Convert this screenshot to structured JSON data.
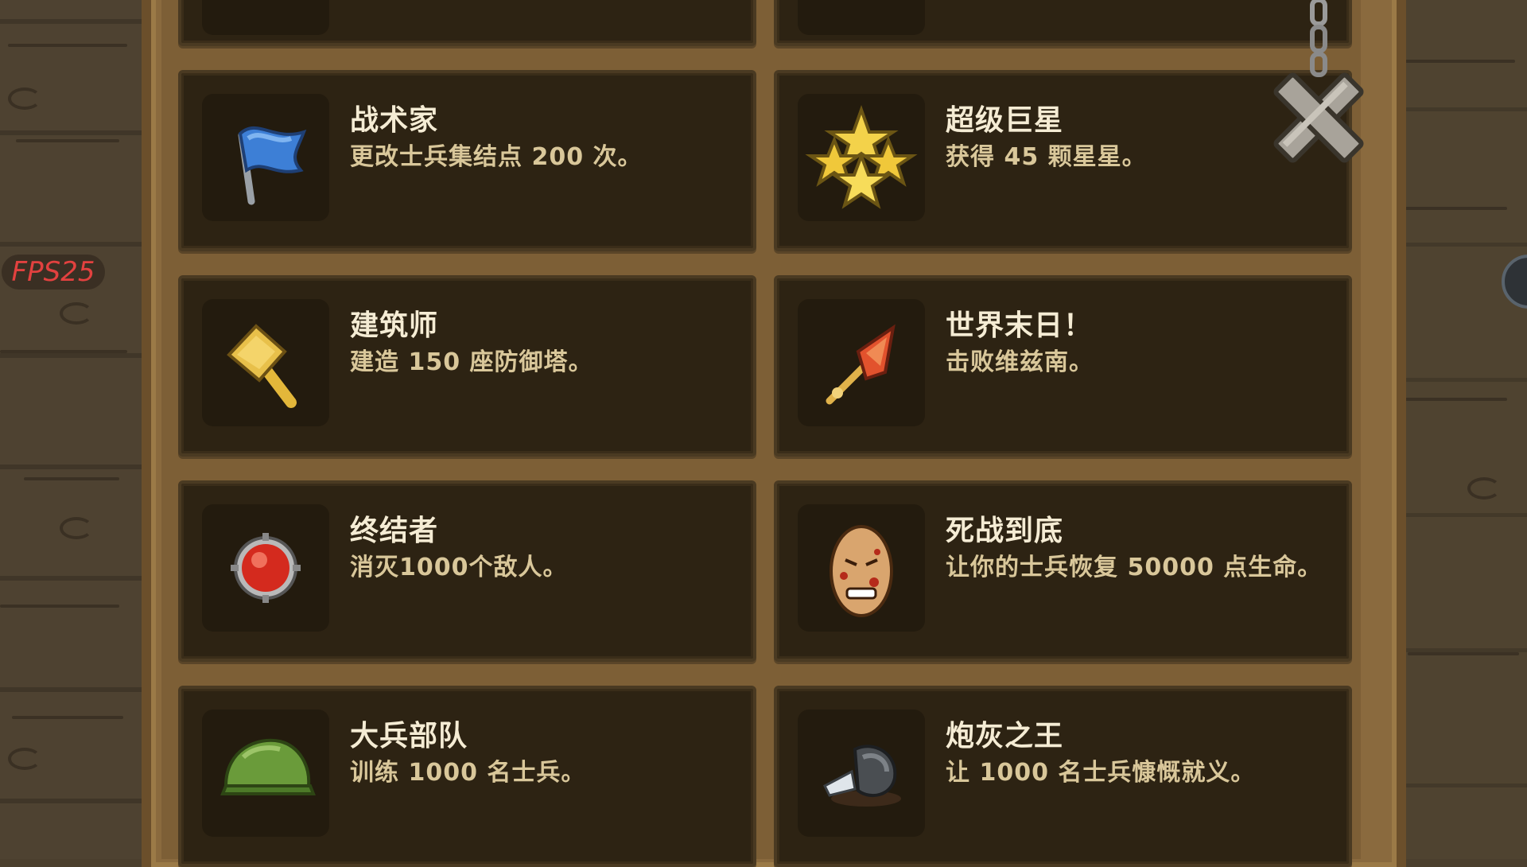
{
  "hud": {
    "fps_label": "FPS25"
  },
  "close_button": {
    "icon": "close-x-icon"
  },
  "achievements": [
    {
      "title": "战术家",
      "description": "更改士兵集结点 200 次。",
      "icon": "blue-flag-icon"
    },
    {
      "title": "超级巨星",
      "description": "获得 45 颗星星。",
      "icon": "stars-icon"
    },
    {
      "title": "建筑师",
      "description": "建造 150 座防御塔。",
      "icon": "hammer-icon"
    },
    {
      "title": "世界末日！",
      "description": "击败维兹南。",
      "icon": "fire-staff-icon"
    },
    {
      "title": "终结者",
      "description": "消灭1000个敌人。",
      "icon": "red-orb-icon"
    },
    {
      "title": "死战到底",
      "description": "让你的士兵恢复 50000 点生命。",
      "icon": "bloody-face-icon"
    },
    {
      "title": "大兵部队",
      "description": "训练 1000 名士兵。",
      "icon": "helmet-icon"
    },
    {
      "title": "炮灰之王",
      "description": "让 1000 名士兵慷慨就义。",
      "icon": "fallen-helmet-icon"
    }
  ]
}
